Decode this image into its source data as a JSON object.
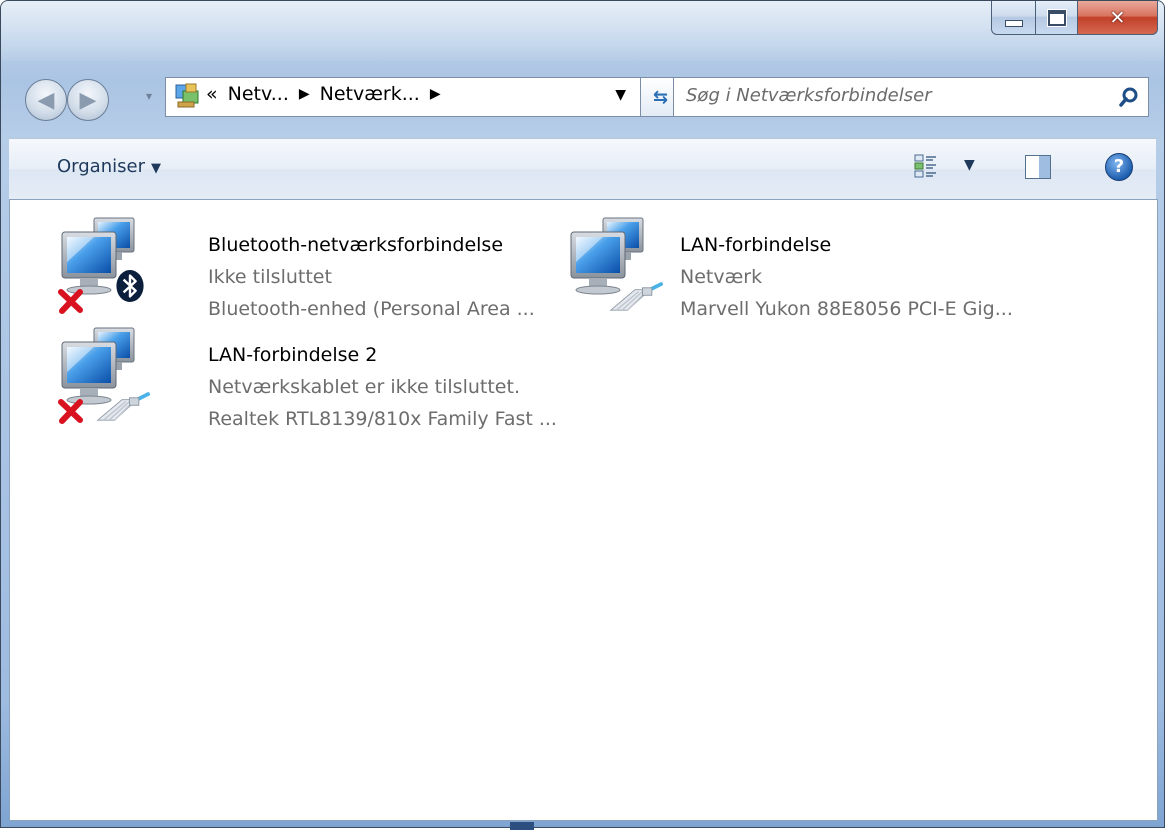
{
  "window": {
    "colors": {
      "frame": "#b9cfe8",
      "close": "#c2402a",
      "accent": "#1e395b"
    }
  },
  "nav": {
    "back_icon": "back-arrow-icon",
    "forward_icon": "forward-arrow-icon",
    "breadcrumb_chevron": "«",
    "breadcrumbs": [
      "Netv...",
      "Netværk..."
    ],
    "search_placeholder": "Søg i Netværksforbindelser"
  },
  "toolbar": {
    "organise_label": "Organiser"
  },
  "connections": [
    {
      "title": "Bluetooth-netværksforbindelse",
      "status": "Ikke tilsluttet",
      "device": "Bluetooth-enhed (Personal Area ...",
      "badge": "bluetooth-icon",
      "disconnected": true
    },
    {
      "title": "LAN-forbindelse",
      "status": "Netværk",
      "device": "Marvell Yukon 88E8056 PCI-E Gig...",
      "badge": "ethernet-cable-icon",
      "disconnected": false
    },
    {
      "title": "LAN-forbindelse 2",
      "status": "Netværkskablet er ikke tilsluttet.",
      "device": "Realtek RTL8139/810x Family Fast ...",
      "badge": "ethernet-cable-icon",
      "disconnected": true
    }
  ]
}
